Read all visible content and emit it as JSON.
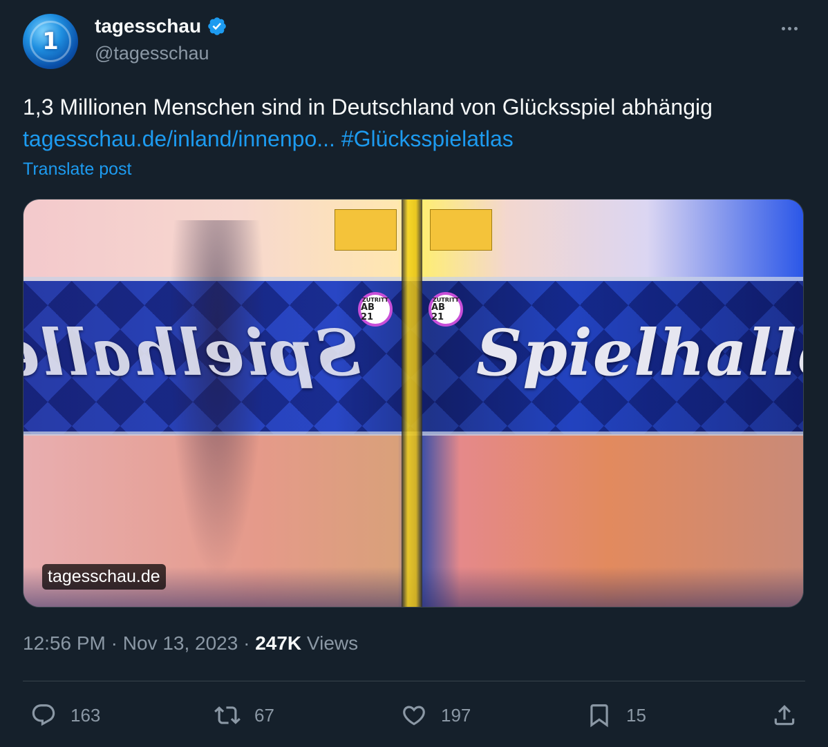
{
  "author": {
    "display_name": "tagesschau",
    "handle": "@tagesschau",
    "avatar_mark": "1",
    "verified": true
  },
  "post": {
    "text": "1,3 Millionen Menschen sind in Deutschland von Glücksspiel abhängig",
    "link_text": "tagesschau.de/inland/innenpo...",
    "hashtag": "#Glücksspielatlas",
    "translate_label": "Translate post"
  },
  "media": {
    "sign_text": "Spielhalle",
    "badge_line1": "ZUTRITT",
    "badge_line2": "AB 21",
    "watermark": "tagesschau.de"
  },
  "meta": {
    "time": "12:56 PM",
    "dot1": " · ",
    "date": "Nov 13, 2023",
    "dot2": " · ",
    "views_count": "247K",
    "views_label": " Views"
  },
  "actions": {
    "replies": "163",
    "reposts": "67",
    "likes": "197",
    "bookmarks": "15"
  },
  "icons": {
    "more": "more-icon",
    "verified": "verified-badge-icon",
    "reply": "reply-icon",
    "repost": "repost-icon",
    "like": "heart-icon",
    "bookmark": "bookmark-icon",
    "share": "share-icon"
  },
  "colors": {
    "background": "#15202b",
    "link": "#1d9bf0",
    "secondary_text": "#8b98a5",
    "primary_text": "#f7f9f9"
  }
}
